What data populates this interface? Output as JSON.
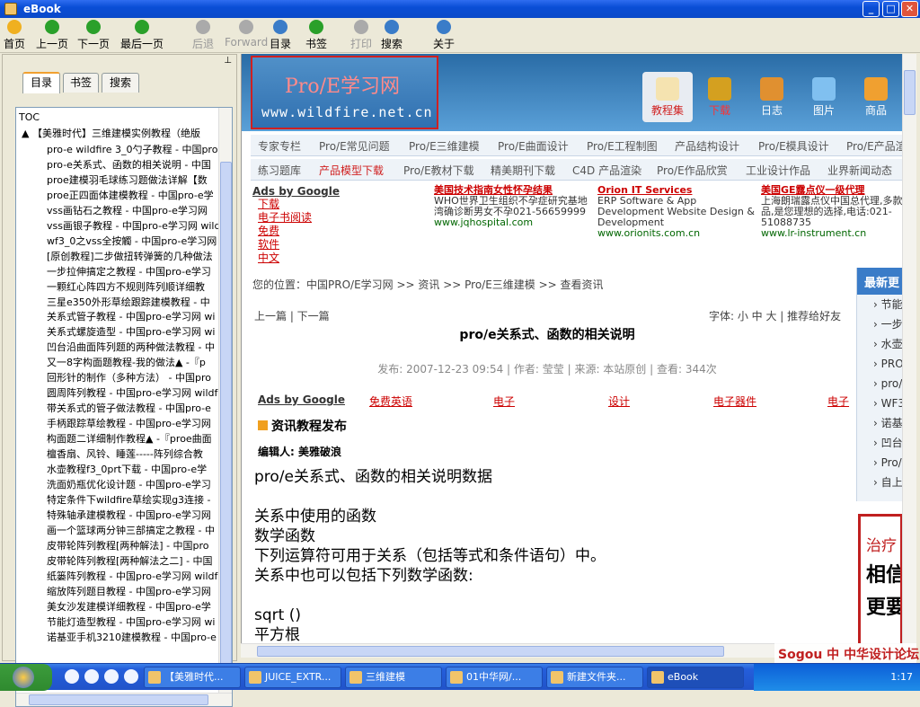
{
  "window": {
    "title": "eBook"
  },
  "toolbar": [
    {
      "label": "首页",
      "icon": "home-icon",
      "enabled": true
    },
    {
      "label": "上一页",
      "icon": "prev-page-icon",
      "enabled": true
    },
    {
      "label": "下一页",
      "icon": "next-page-icon",
      "enabled": true
    },
    {
      "label": "最后一页",
      "icon": "last-page-icon",
      "enabled": true
    },
    {
      "label": "后退",
      "icon": "back-icon",
      "enabled": false
    },
    {
      "label": "Forward",
      "icon": "forward-icon",
      "enabled": false
    },
    {
      "label": "目录",
      "icon": "toc-icon",
      "enabled": true
    },
    {
      "label": "书签",
      "icon": "bookmark-icon",
      "enabled": true
    },
    {
      "label": "打印",
      "icon": "print-icon",
      "enabled": false
    },
    {
      "label": "搜索",
      "icon": "search-icon",
      "enabled": true
    },
    {
      "label": "关于",
      "icon": "about-icon",
      "enabled": true
    }
  ],
  "left_pane": {
    "tabs": [
      "目录",
      "书签",
      "搜索"
    ],
    "toc_label": "TOC",
    "toc_root": "【美雅时代】三维建模实例教程（绝版",
    "toc_items": [
      "pro-e wildfire 3_0勺子教程 - 中国pro-e",
      "pro-e关系式、函数的相关说明 - 中国",
      "proe建模羽毛球练习题做法详解【数",
      "proe正四面体建模教程 - 中国pro-e学",
      "vss画钻石之教程 - 中国pro-e学习网",
      "vss画银子教程 - 中国pro-e学习网 wild",
      "wf3_0之vss全按觸 - 中国pro-e学习网",
      "[原创教程]二步做扭转弹簧的几种做法",
      "一步拉伸搞定之教程 - 中国pro-e学习",
      "一颗红心阵四方不规则阵列顺详细教",
      "三星e350外形草绘跟踪建模教程 - 中",
      "关系式管子教程 - 中国pro-e学习网 wi",
      "关系式螺旋造型 - 中国pro-e学习网 wi",
      "凹台沿曲面阵列题的两种做法教程 - 中",
      "又一8字构面题教程-我的做法▲ -『p",
      "回形针的制作（多种方法） - 中国pro",
      "圆周阵列教程 - 中国pro-e学习网 wildf",
      "带关系式的管子做法教程 - 中国pro-e",
      "手柄跟踪草绘教程 - 中国pro-e学习网",
      "构面题二详细制作教程▲ -『proe曲面",
      "檀香扇、风铃、睡莲-----阵列综合教",
      "水壶教程f3_0prt下载 - 中国pro-e学",
      "洗面奶瓶优化设计题 - 中国pro-e学习",
      "特定条件下wildfire草绘实现g3连接 -",
      "特殊轴承建模教程 - 中国pro-e学习网",
      "画一个篮球两分钟三部搞定之教程 - 中",
      "皮带轮阵列教程[两种解法] - 中国pro",
      "皮带轮阵列教程[两种解法之二] - 中国",
      "纸篓阵列教程 - 中国pro-e学习网 wildf",
      "缩放阵列题目教程 - 中国pro-e学习网",
      "美女沙发建模详细教程 - 中国pro-e学",
      "节能灯造型教程 - 中国pro-e学习网 wi",
      "诺基亚手机3210建模教程 - 中国pro-e"
    ]
  },
  "site": {
    "logo_text": "Pro/E学习网",
    "logo_url": "www.wildfire.net.cn",
    "top_nav": [
      "教程集",
      "下载",
      "日志",
      "图片",
      "商品"
    ],
    "nav_row1": [
      "专家专栏",
      "Pro/E常见问题",
      "Pro/E三维建模",
      "Pro/E曲面设计",
      "Pro/E工程制图",
      "产品结构设计",
      "Pro/E模具设计",
      "Pro/E产品渲"
    ],
    "nav_row2": [
      "练习题库",
      "产品模型下载",
      "Pro/E教材下载",
      "精美期刊下载",
      "C4D 产品渲染",
      "Pro/E作品欣赏",
      "工业设计作品",
      "业界新闻动态"
    ],
    "ads_by_google": "Ads by Google",
    "ad_links": [
      "下载",
      "电子书阅读",
      "免费",
      "软件",
      "中文"
    ],
    "ad_blocks": [
      {
        "head": "美国技术指南女性怀孕结果",
        "body": "WHO世界卫生组织不孕症研究基地 湾确诊断男女不孕021-56659999",
        "url": "www.jqhospital.com"
      },
      {
        "head": "Orion IT Services",
        "body": "ERP Software & App Development Website Design & Development",
        "url": "www.orionits.com.cn"
      },
      {
        "head": "美国GE露点仪一级代理",
        "body": "上海朗瑞露点仪中国总代理,多款优品,是您理想的选择,电话:021-51088735",
        "url": "www.lr-instrument.cn"
      }
    ],
    "breadcrumb": "您的位置：中国PRO/E学习网 >> 资讯 >> Pro/E三维建模 >> 查看资讯",
    "sidebar_title": "最新更",
    "sidebar_items": [
      "节能灯",
      "一步拉",
      "水壶教",
      "PROE",
      "pro/e",
      "WF3.0",
      "诺基亚",
      "凹台沿",
      "Pro/E",
      "自上而"
    ],
    "article_nav": "上一篇 | 下一篇",
    "font_opts": "字体: 小 中 大 | 推荐给好友",
    "article_title": "pro/e关系式、函数的相关说明",
    "meta": "发布: 2007-12-23 09:54 | 作者: 莹莹 | 来源: 本站原创 | 查看: 344次",
    "ads2": [
      "Ads by Google",
      "免费英语",
      "电子",
      "设计",
      "电子器件",
      "电子"
    ],
    "section_title": "资讯教程发布",
    "editor": "编辑人: 美雅破浪",
    "body": [
      "pro/e关系式、函数的相关说明数据",
      "",
      "关系中使用的函数",
      "数学函数",
      "下列运算符可用于关系（包括等式和条件语句）中。",
      "关系中也可以包括下列数学函数:",
      "",
      "sqrt ()",
      "平方根"
    ],
    "banner": [
      "治疗",
      "相信",
      "更要"
    ]
  },
  "taskbar": {
    "tasks": [
      "【美雅时代...",
      "JUICE_EXTR...",
      "三维建模",
      "01中华网/...",
      "新建文件夹...",
      "eBook"
    ],
    "active": 5,
    "clock": "1:17",
    "watermark": "中华设计论坛"
  },
  "colors": {
    "title_bar": "#0a4ed6",
    "accent_red": "#d02020",
    "link_red": "#cc0000",
    "site_band": "#2a6ca6"
  }
}
